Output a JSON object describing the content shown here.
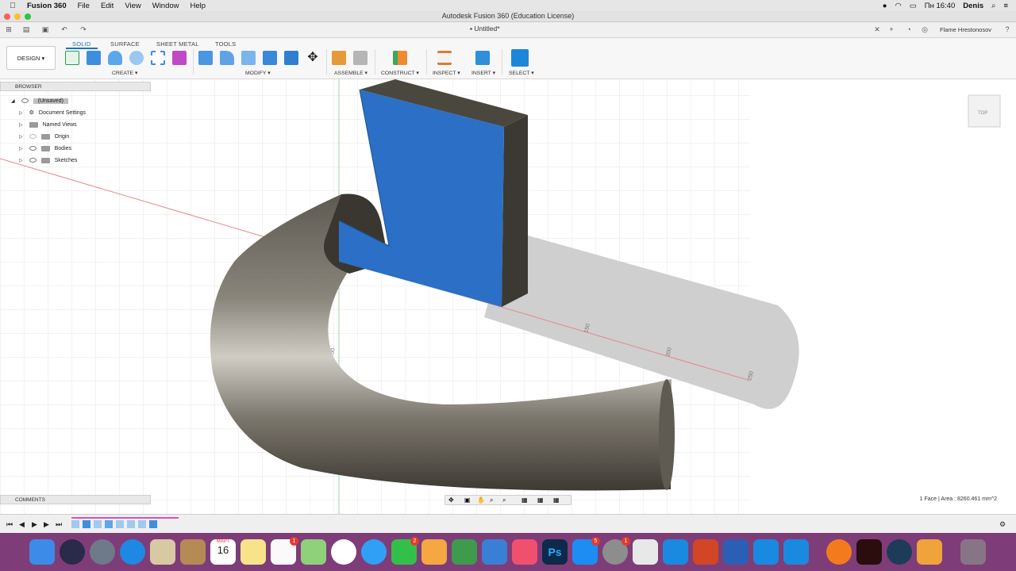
{
  "menubar": {
    "app_name": "Fusion 360",
    "items": [
      "File",
      "Edit",
      "View",
      "Window",
      "Help"
    ],
    "clock": "Пн 16:40",
    "user": "Denis"
  },
  "window": {
    "title": "Autodesk Fusion 360 (Education License)"
  },
  "quick_access": {
    "document_tab": "Untitled*",
    "account_name": "Flame Hrestonosov"
  },
  "ribbon": {
    "tabs": [
      "SOLID",
      "SURFACE",
      "SHEET METAL",
      "TOOLS"
    ],
    "workspace": "DESIGN ▾",
    "groups": [
      "CREATE ▾",
      "MODIFY ▾",
      "ASSEMBLE ▾",
      "CONSTRUCT ▾",
      "INSPECT ▾",
      "INSERT ▾",
      "SELECT ▾"
    ]
  },
  "browser": {
    "header": "BROWSER",
    "root": "(Unsaved)",
    "items": [
      "Document Settings",
      "Named Views",
      "Origin",
      "Bodies",
      "Sketches"
    ]
  },
  "comments": {
    "header": "COMMENTS"
  },
  "status": {
    "text": "1 Face | Area : 8260.461 mm^2"
  },
  "viewport": {
    "axis_labels": [
      "50",
      "150",
      "200",
      "250"
    ],
    "viewcube_face": "TOP",
    "accent": "#2a72c9"
  },
  "dock": {
    "calendar_month": "МАРТ",
    "calendar_day": "16",
    "badges": [
      "1",
      "2",
      "5",
      "1"
    ]
  }
}
